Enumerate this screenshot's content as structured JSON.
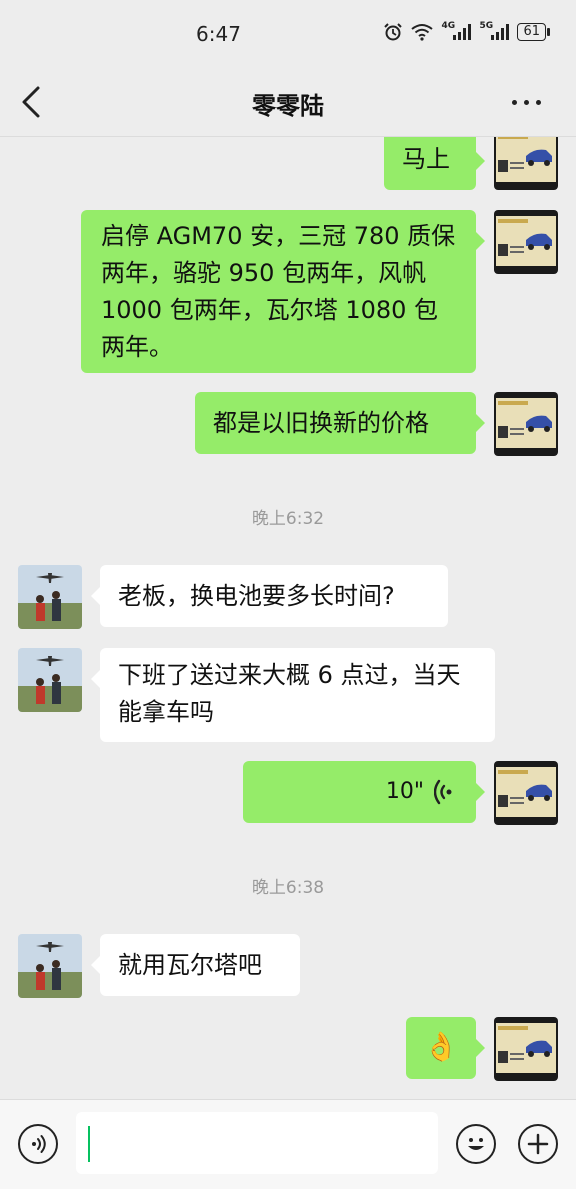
{
  "status": {
    "time": "6:47",
    "net1": "4G",
    "net2": "5G",
    "battery": "61"
  },
  "nav": {
    "title": "零零陆"
  },
  "messages": [
    {
      "text": "马上"
    },
    {
      "text": "启停 AGM70 安，三冠 780 质保两年，骆驼 950 包两年，风帆1000 包两年，瓦尔塔 1080 包两年。"
    },
    {
      "text": "都是以旧换新的价格"
    },
    {
      "text": "老板，换电池要多长时间?"
    },
    {
      "text": "下班了送过来大概 6 点过，当天能拿车吗"
    },
    {
      "text": "就用瓦尔塔吧"
    }
  ],
  "timestamps": [
    "晚上6:32",
    "晚上6:38"
  ],
  "voice": {
    "duration": "10\""
  },
  "emoji": {
    "name": "ok-hand-emoji",
    "glyph": "👌"
  },
  "colors": {
    "sent_bubble": "#95ec69",
    "received_bubble": "#ffffff",
    "background": "#ededed",
    "caret": "#07c160"
  },
  "icons": [
    "back-arrow-icon",
    "more-icon",
    "voice-icon",
    "emoji-icon",
    "plus-icon"
  ]
}
